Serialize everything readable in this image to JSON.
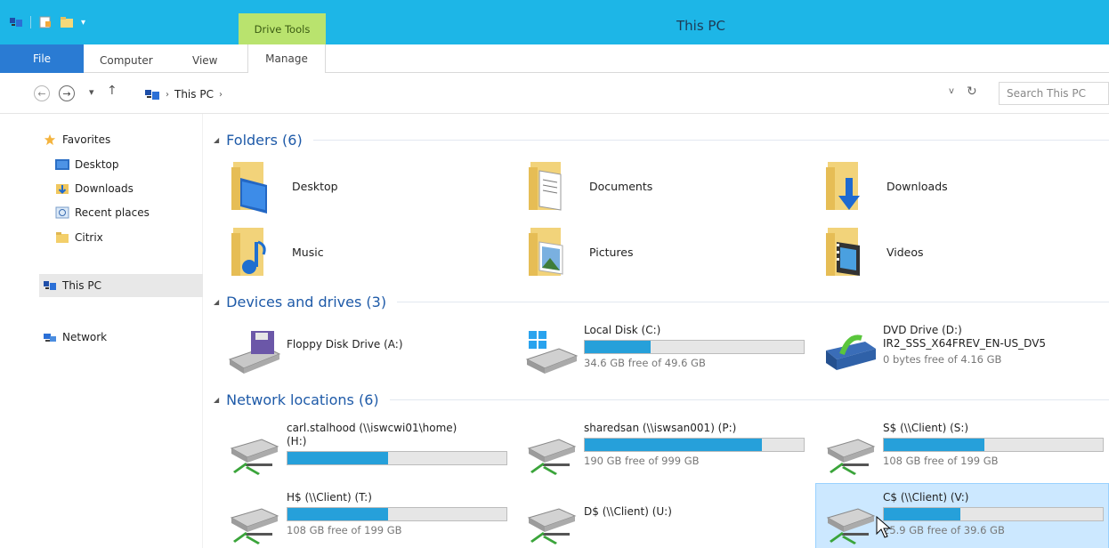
{
  "window": {
    "title": "This PC"
  },
  "ribbon": {
    "context_tab": "Drive Tools",
    "tabs": [
      "File",
      "Computer",
      "View",
      "Manage"
    ]
  },
  "address": {
    "path": "This PC",
    "separator": "›",
    "dropdown": "v",
    "search_placeholder": "Search This PC"
  },
  "nav": {
    "favorites": "Favorites",
    "desktop": "Desktop",
    "downloads": "Downloads",
    "recent": "Recent places",
    "citrix": "Citrix",
    "thispc": "This PC",
    "network": "Network"
  },
  "groups": {
    "folders": "Folders (6)",
    "devices": "Devices and drives (3)",
    "network": "Network locations (6)"
  },
  "folders": [
    {
      "name": "Desktop",
      "icon": "desktop-folder-icon"
    },
    {
      "name": "Documents",
      "icon": "documents-folder-icon"
    },
    {
      "name": "Downloads",
      "icon": "downloads-folder-icon"
    },
    {
      "name": "Music",
      "icon": "music-folder-icon"
    },
    {
      "name": "Pictures",
      "icon": "pictures-folder-icon"
    },
    {
      "name": "Videos",
      "icon": "videos-folder-icon"
    }
  ],
  "devices": {
    "floppy": {
      "name": "Floppy Disk Drive (A:)"
    },
    "c": {
      "name": "Local Disk (C:)",
      "free": "34.6 GB free of 49.6 GB",
      "used_fraction": 0.3
    },
    "dvd": {
      "name": "DVD Drive (D:)",
      "label": "IR2_SSS_X64FREV_EN-US_DV5",
      "free": "0 bytes free of 4.16 GB"
    }
  },
  "network_locations": {
    "h": {
      "name": "carl.stalhood (\\\\iswcwi01\\home)",
      "name2": "(H:)",
      "used_fraction": 0.46
    },
    "p": {
      "name": "sharedsan (\\\\iswsan001) (P:)",
      "free": "190 GB free of 999 GB",
      "used_fraction": 0.81
    },
    "s": {
      "name": "S$ (\\\\Client) (S:)",
      "free": "108 GB free of 199 GB",
      "used_fraction": 0.46
    },
    "t": {
      "name": "H$ (\\\\Client) (T:)",
      "free": "108 GB free of 199 GB",
      "used_fraction": 0.46
    },
    "u": {
      "name": "D$ (\\\\Client) (U:)"
    },
    "v": {
      "name": "C$ (\\\\Client) (V:)",
      "free": "25.9 GB free of 39.6 GB",
      "used_fraction": 0.35
    }
  },
  "colors": {
    "titlebar": "#1db6e7",
    "file_tab": "#2a7bd3",
    "drive_tools": "#b9e36e",
    "bar_fill": "#26a0da",
    "selection": "#cce8ff"
  }
}
